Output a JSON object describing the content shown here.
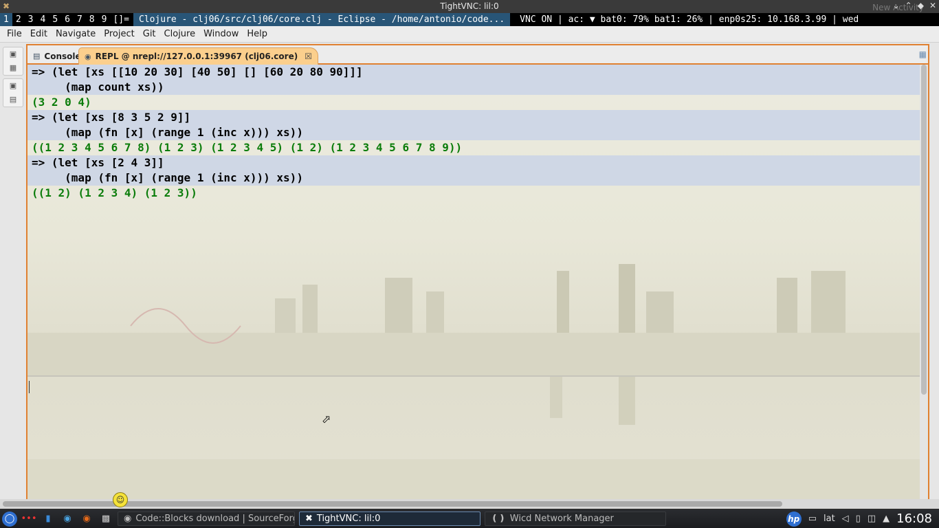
{
  "vnc_window": {
    "title": "TightVNC: lil:0",
    "ghost_text": "New Activity",
    "controls": [
      "⌄",
      "⌃",
      "◆",
      "✕"
    ]
  },
  "i3bar": {
    "workspaces": [
      "1",
      "2",
      "3",
      "4",
      "5",
      "6",
      "7",
      "8",
      "9"
    ],
    "active_workspace": "1",
    "layout_indicator": "[]=",
    "window_title": "Clojure - clj06/src/clj06/core.clj - Eclipse - /home/antonio/code...",
    "status": "VNC ON | ac: ▼ bat0: 79% bat1: 26% | enp0s25: 10.168.3.99 | wed"
  },
  "menubar": {
    "items": [
      "File",
      "Edit",
      "Navigate",
      "Project",
      "Git",
      "Clojure",
      "Window",
      "Help"
    ]
  },
  "tabs": {
    "console": "Console",
    "repl": "REPL @ nrepl://127.0.0.1:39967 (clj06.core)"
  },
  "repl": {
    "lines": [
      {
        "kind": "in",
        "text": "=> (let [xs [[10 20 30] [40 50] [] [60 20 80 90]]]"
      },
      {
        "kind": "in",
        "text": "     (map count xs))"
      },
      {
        "kind": "out",
        "text": "(3 2 0 4)"
      },
      {
        "kind": "in",
        "text": "=> (let [xs [8 3 5 2 9]]"
      },
      {
        "kind": "in",
        "text": "     (map (fn [x] (range 1 (inc x))) xs))"
      },
      {
        "kind": "out",
        "text": "((1 2 3 4 5 6 7 8) (1 2 3) (1 2 3 4 5) (1 2) (1 2 3 4 5 6 7 8 9))"
      },
      {
        "kind": "in",
        "text": "=> (let [xs [2 4 3]]"
      },
      {
        "kind": "in",
        "text": "     (map (fn [x] (range 1 (inc x))) xs))"
      },
      {
        "kind": "out",
        "text": "((1 2) (1 2 3 4) (1 2 3))"
      }
    ],
    "input_value": ""
  },
  "taskbar": {
    "tasks": [
      {
        "label": "Code::Blocks download | SourceForge",
        "active": false
      },
      {
        "label": "TightVNC: lil:0",
        "active": true
      },
      {
        "label": "Wicd Network Manager",
        "active": false
      }
    ],
    "keyboard_layout": "lat",
    "clock": "16:08"
  },
  "colors": {
    "accent": "#e08030",
    "repl_input_bg": "#cdd6e6",
    "repl_output": "#0a7c0a",
    "keyword": "#7b2a4f",
    "function": "#1e7fa8",
    "number": "#2020c8"
  }
}
